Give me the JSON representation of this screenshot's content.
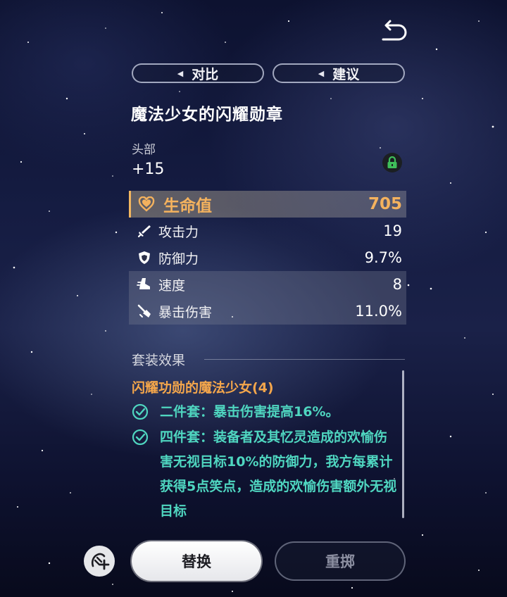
{
  "toolbar": {
    "compare_label": "对比",
    "suggest_label": "建议"
  },
  "relic": {
    "name": "魔法少女的闪耀勋章",
    "slot": "头部",
    "level": "+15",
    "locked": true,
    "main_stat": {
      "label": "生命值",
      "value": "705",
      "icon": "heart-icon"
    },
    "sub_stats": [
      {
        "label": "攻击力",
        "value": "19",
        "icon": "sword-icon"
      },
      {
        "label": "防御力",
        "value": "9.7%",
        "icon": "shield-icon"
      },
      {
        "label": "速度",
        "value": "8",
        "icon": "boot-icon"
      },
      {
        "label": "暴击伤害",
        "value": "11.0%",
        "icon": "crit-damage-icon"
      }
    ]
  },
  "set_bonus": {
    "header": "套装效果",
    "name": "闪耀功勋的魔法少女(4)",
    "effects": [
      {
        "text": "二件套：暴击伤害提高16%。",
        "active": true
      },
      {
        "text": "四件套：装备者及其忆灵造成的欢愉伤害无视目标10%的防御力，我方每累计获得5点笑点，造成的欢愉伤害额外无视目标",
        "active": true
      }
    ]
  },
  "actions": {
    "replace_label": "替换",
    "reroll_label": "重掷"
  },
  "colors": {
    "accent_gold": "#f4b25e",
    "set_name": "#f4a64b",
    "set_effect": "#4fd6c0",
    "lock_green": "#3fbf5a"
  }
}
